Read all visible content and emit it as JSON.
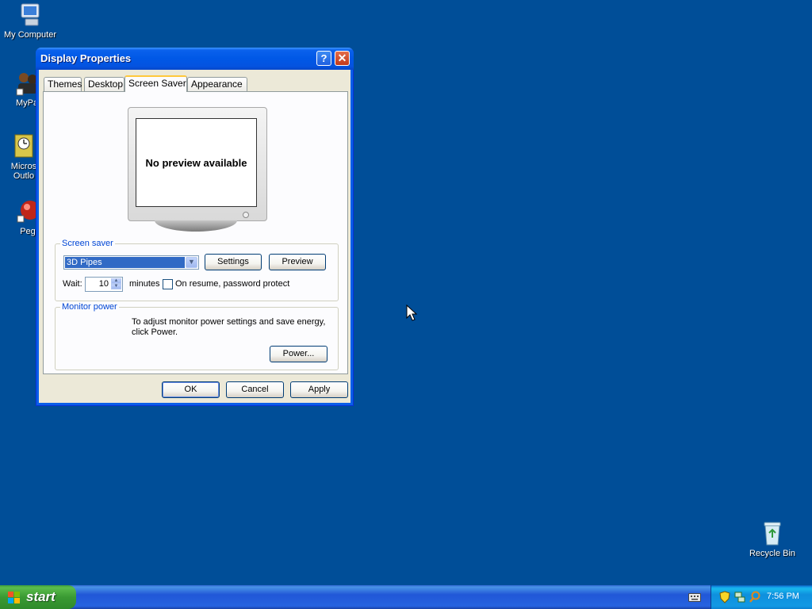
{
  "desktop": {
    "icons": [
      {
        "label": "My Computer"
      },
      {
        "label": "MyPa"
      },
      {
        "label": "Micros\nOutlo"
      },
      {
        "label": "Peg"
      },
      {
        "label": "Recycle Bin"
      }
    ]
  },
  "window": {
    "title": "Display Properties",
    "help_label": "?",
    "close_label": "✕",
    "tabs": [
      {
        "label": "Themes"
      },
      {
        "label": "Desktop"
      },
      {
        "label": "Screen Saver",
        "active": true
      },
      {
        "label": "Appearance"
      }
    ],
    "preview_text": "No preview available",
    "screen_saver": {
      "legend": "Screen saver",
      "selected": "3D Pipes",
      "settings_label": "Settings",
      "preview_label": "Preview",
      "wait_label": "Wait:",
      "wait_value": "10",
      "minutes_label": "minutes",
      "password_label": "On resume, password protect",
      "password_checked": false
    },
    "monitor_power": {
      "legend": "Monitor power",
      "description": "To adjust monitor power settings and save energy, click Power.",
      "power_label": "Power..."
    },
    "buttons": {
      "ok": "OK",
      "cancel": "Cancel",
      "apply": "Apply"
    }
  },
  "taskbar": {
    "start_label": "start",
    "clock": "7:56 PM"
  },
  "colors": {
    "desktop": "#004e98",
    "titlebar": "#0058e6",
    "start": "#3a9a33",
    "accent_tab": "#ffc83c"
  }
}
